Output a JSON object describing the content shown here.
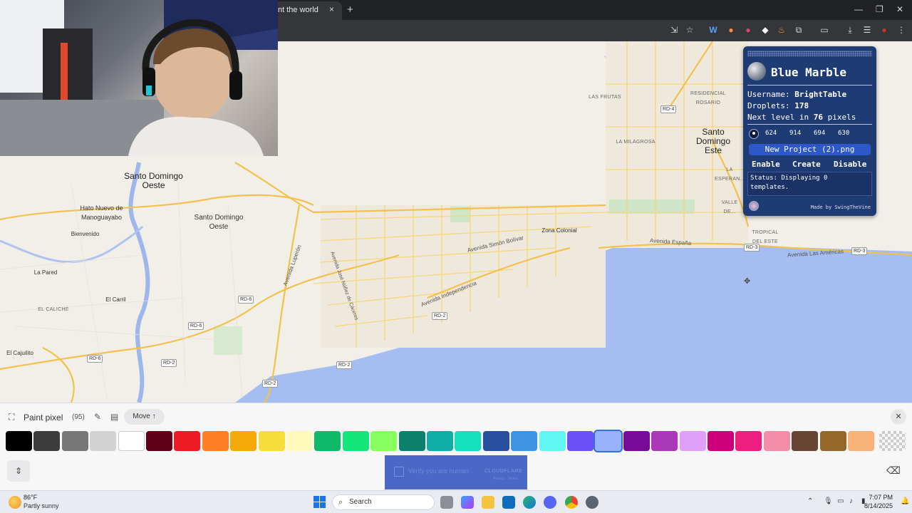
{
  "browser": {
    "tab_title": "nt the world",
    "tab_close": "×",
    "new_tab": "+",
    "window_minimize": "—",
    "window_maximize": "❐",
    "window_close": "✕"
  },
  "map": {
    "places": {
      "santo_domingo_oeste_big": "Santo Domingo Oeste",
      "santo_domingo_oeste_small": "Santo Domingo Oeste",
      "hato_nuevo": "Hato Nuevo de Manoguayabo",
      "bienvenido": "Bienvenido",
      "la_pared": "La Pared",
      "el_carril": "El Carril",
      "el_caliche": "EL CALICHE",
      "el_cajuilito": "El Cajuilito",
      "zona_colonial": "Zona Colonial",
      "santo_domingo_este": "Santo Domingo Este",
      "las_frutas": "LAS FRUTAS",
      "residencial": "RESIDENCIAL ROSARIO",
      "la_milagrosa": "LA MILAGROSA",
      "la_esperanza": "LA ESPERAN...",
      "valle_del_este": "VALLE DE...",
      "tropical_del_este": "TROPICAL DEL ESTE"
    },
    "streets": {
      "simon_bolivar": "Avenida Simón Bolívar",
      "independencia": "Avenida Independencia",
      "luperon": "Avenida Luperón",
      "nunez": "Avenida José Núñez de Cáceres",
      "espana": "Avenida España",
      "las_americas": "Avenida Las Américas"
    },
    "roads": {
      "rd4": "RD-4",
      "rd6a": "RD-6",
      "rd6b": "RD-6",
      "rd6c": "RD-6",
      "rd2a": "RD-2",
      "rd2b": "RD-2",
      "rd2c": "RD-2",
      "rd2d": "RD-2",
      "rd3a": "RD-3",
      "rd3b": "RD-3"
    }
  },
  "blue_marble": {
    "title": "Blue Marble",
    "username_label": "Username:",
    "username": "BrightTable",
    "droplets_label": "Droplets:",
    "droplets": "178",
    "next_level_prefix": "Next level in",
    "next_level_value": "76",
    "next_level_suffix": "pixels",
    "coords": [
      "624",
      "914",
      "694",
      "630"
    ],
    "project": "New Project (2).png",
    "enable": "Enable",
    "create": "Create",
    "disable": "Disable",
    "status": "Status: Displaying 0 templates.",
    "made_by": "Made by SwingTheVine"
  },
  "paint": {
    "title": "Paint pixel",
    "count": "(95)",
    "move_label": "Move ↑",
    "close": "✕",
    "palette": [
      "#000000",
      "#3c3c3c",
      "#787878",
      "#d2d2d2",
      "#ffffff",
      "#600018",
      "#ed1c24",
      "#ff7f27",
      "#f6aa09",
      "#f9dd3b",
      "#fffabc",
      "#0eb968",
      "#13e67b",
      "#87ff5e",
      "#0c816e",
      "#10aea6",
      "#13e1be",
      "#28509e",
      "#4093e4",
      "#60f7f2",
      "#6b50f6",
      "#99b1fb",
      "#780c99",
      "#aa38b9",
      "#e09ff9",
      "#cb007a",
      "#ec1f80",
      "#f38da9",
      "#684634",
      "#95682a",
      "#f8b277"
    ],
    "selected_index": 21,
    "captcha_text": "Verify you are human",
    "captcha_brand": "CLOUDFLARE",
    "captcha_links": "Privacy · Terms"
  },
  "taskbar": {
    "weather_temp": "86°F",
    "weather_desc": "Partly sunny",
    "search": "Search",
    "time": "7:07 PM",
    "date": "8/14/2025"
  }
}
